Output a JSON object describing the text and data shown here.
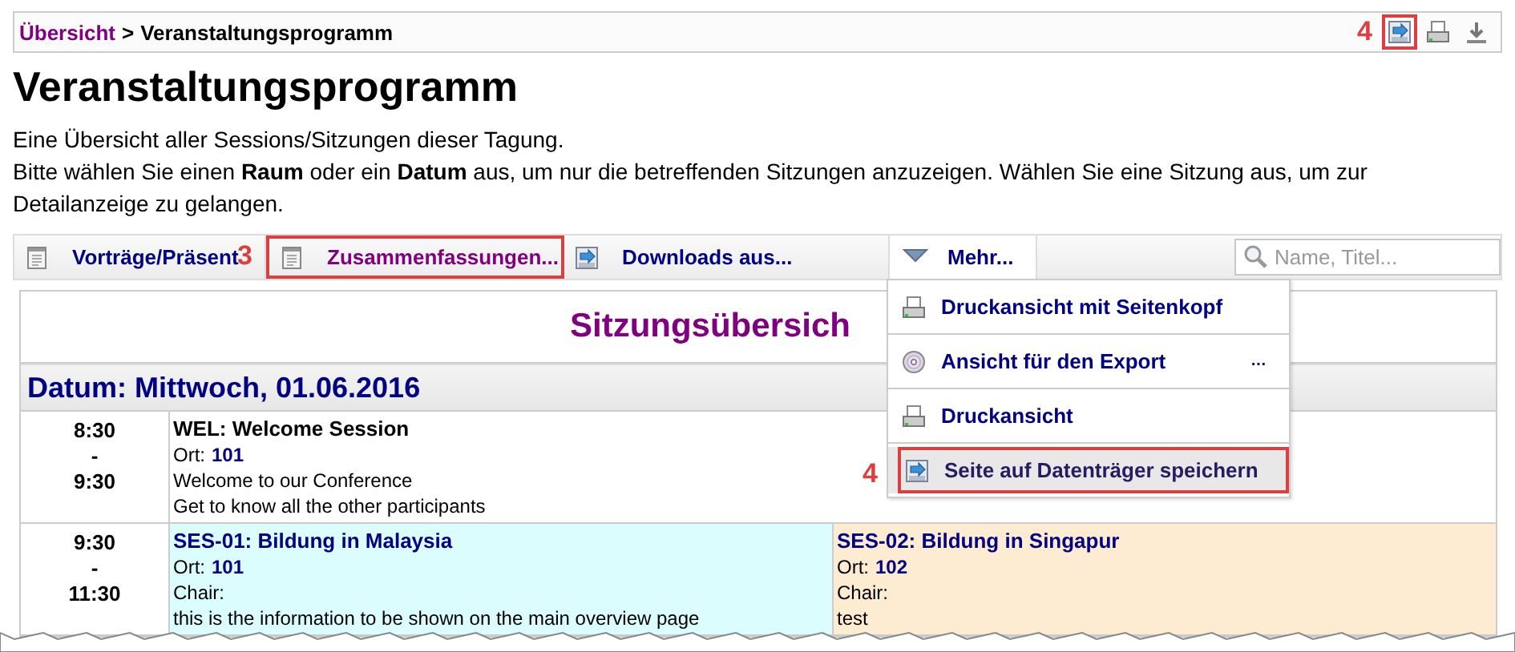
{
  "breadcrumb": {
    "link": "Übersicht",
    "separator": ">",
    "current": "Veranstaltungsprogramm"
  },
  "page_actions": [
    {
      "kind": "save",
      "highlighted": true,
      "callout": "4"
    },
    {
      "kind": "print",
      "highlighted": false
    },
    {
      "kind": "download",
      "highlighted": false
    }
  ],
  "title": "Veranstaltungsprogramm",
  "intro": [
    "Eine Übersicht aller Sessions/Sitzungen dieser Tagung.",
    "Bitte wählen Sie einen **Raum** oder ein **Datum** aus, um nur die betreffenden Sitzungen anzuzeigen. Wählen Sie eine Sitzung aus, um zur Detailanzeige zu gelangen."
  ],
  "toolbar": {
    "items": [
      {
        "label": "Vorträge/Präsent",
        "kind": "document",
        "highlighted": false
      },
      {
        "label": "Zusammenfassungen...",
        "kind": "document",
        "highlighted": true,
        "callout": "3"
      },
      {
        "label": "Downloads aus...",
        "kind": "save",
        "highlighted": false
      }
    ],
    "more": {
      "label": "Mehr...",
      "expanded": true
    },
    "search": {
      "placeholder": "Name, Titel..."
    }
  },
  "menu": [
    {
      "label": "Druckansicht mit Seitenkopf",
      "kind": "print",
      "highlighted": false
    },
    {
      "label": "Ansicht für den Export",
      "kind": "disc",
      "highlighted": false,
      "submenu_marker": "…"
    },
    {
      "label": "Druckansicht",
      "kind": "print",
      "highlighted": false
    },
    {
      "label": "Seite auf Datenträger speichern",
      "kind": "save",
      "highlighted": true,
      "callout": "4"
    }
  ],
  "schedule": {
    "title": "Sitzungsübersich",
    "days": [
      {
        "date": "Datum: Mittwoch, 01.06.2016",
        "slots": [
          {
            "start": "8:30",
            "separator": "-",
            "end": "9:30",
            "sessions": [
              {
                "title": "WEL: Welcome Session",
                "kind": "plenary",
                "color": "#ffffff",
                "location_label": "Ort:",
                "location": "101",
                "lines": [
                  "Welcome to our Conference",
                  "Get to know all the other participants"
                ]
              }
            ]
          },
          {
            "start": "9:30",
            "separator": "-",
            "end": "11:30",
            "sessions": [
              {
                "title": "SES-01: Bildung in Malaysia",
                "kind": "parallel",
                "color": "#dcfdfd",
                "location_label": "Ort:",
                "location": "101",
                "chair_label": "Chair:",
                "lines": [
                  "this is the information to be shown on the main overview page"
                ]
              },
              {
                "title": "SES-02: Bildung in Singapur",
                "kind": "parallel",
                "color": "#fdebd2",
                "location_label": "Ort:",
                "location": "102",
                "chair_label": "Chair:",
                "lines": [
                  "test"
                ]
              }
            ]
          }
        ]
      }
    ]
  }
}
